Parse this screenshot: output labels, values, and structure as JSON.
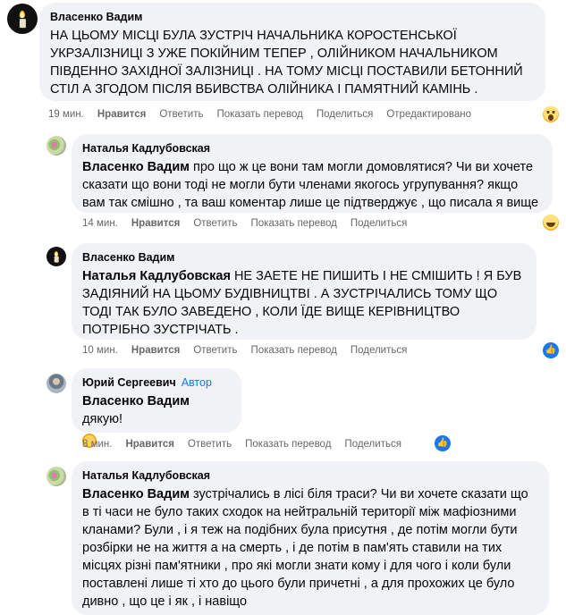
{
  "comments": [
    {
      "author": "Власенко Вадим",
      "text": "НА ЦЬОМУ МІСЦІ БУЛА ЗУСТРІЧ НАЧАЛЬНИКА КОРОСТЕНСЬКОЇ УКРЗАЛІЗНИЦІ З УЖЕ ПОКІЙНИМ ТЕПЕР , ОЛІЙНИКОМ НАЧАЛЬНИКОМ ПІВДЕННО ЗАХІДНОЇ ЗАЛІЗНИЦІ . НА ТОМУ МІСЦІ ПОСТАВИЛИ БЕТОННИЙ СТІЛ А ЗГОДОМ ПІСЛЯ ВБИВСТВА ОЛІЙНИКА І ПАМЯТНИЙ КАМІНЬ .",
      "time": "19 мин.",
      "like": "Нравится",
      "reply": "Ответить",
      "translate": "Показать перевод",
      "share": "Поделиться",
      "edited": "Отредактировано",
      "reaction": "wow-icon"
    },
    {
      "author": "Наталья Кадлубовская",
      "mention": "Власенко Вадим",
      "text": " про що ж це вони там могли домовлятися? Чи ви хочете сказати що вони тоді не могли бути членами якогось угрупування? якщо вам так смішно , та ваш коментар лише це підтверджує , що писала я вище",
      "time": "14 мин.",
      "like": "Нравится",
      "reply": "Ответить",
      "translate": "Показать перевод",
      "share": "Поделиться",
      "reaction": "haha-icon"
    },
    {
      "author": "Власенко Вадим",
      "mention": "Наталья Кадлубовская",
      "text": " НЕ ЗАЕТЕ НЕ ПИШИТЬ І НЕ СМІШИТЬ ! Я БУВ ЗАДІЯНИЙ НА ЦЬОМУ БУДІВНИЦТВІ . А ЗУСТРІЧАЛИСЬ ТОМУ ЩО ТОДІ ТАК БУЛО ЗАВЕДЕНО , КОЛИ ЇДЕ ВИЩЕ КЕРІВНИЦТВО ПОТРІБНО ЗУСТРІЧАТЬ .",
      "time": "10 мин.",
      "like": "Нравится",
      "reply": "Ответить",
      "translate": "Показать перевод",
      "share": "Поделиться",
      "reaction": "like-icon"
    },
    {
      "author": "Юрий Сергеевич",
      "badge": "Автор",
      "mention": "Власенко Вадим",
      "text": " дякую!",
      "time": "8 мин.",
      "like": "Нравится",
      "reply": "Ответить",
      "translate": "Показать перевод",
      "share": "Поделиться",
      "reaction": "like-icon"
    },
    {
      "author": "Наталья Кадлубовская",
      "mention": "Власенко Вадим",
      "text": " зустрічались в лісі біля траси? Чи ви хочете сказати що в ті часи не було таких сходок на нейтральній території між мафіозними кланами? Були , і я теж на подібних була присутня , де потім могли бути розбірки не на життя а на смерть , і де потім в пам'ять ставили на тих місцях різні пам'ятники , про які могли знати кому і для чого і коли були поставлені лише ті хто до цього були причетні , а для прохожих це було дивно , що це і як , і навіщо"
    }
  ],
  "icons": {
    "like_glyph": "👍"
  }
}
